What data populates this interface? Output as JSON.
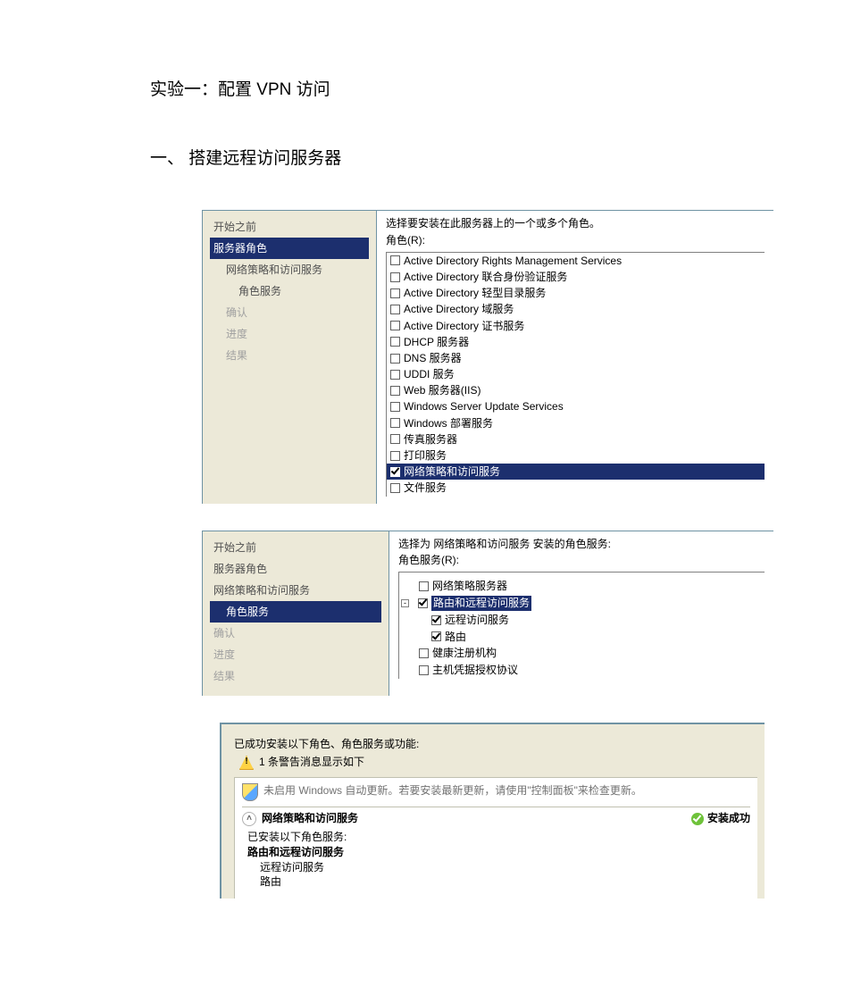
{
  "doc": {
    "title": "实验一：配置 VPN 访问",
    "subtitle": "一、  搭建远程访问服务器"
  },
  "dlg1": {
    "sidebar": {
      "s0": "开始之前",
      "s1": "服务器角色",
      "s2": "网络策略和访问服务",
      "s3": "角色服务",
      "s4": "确认",
      "s5": "进度",
      "s6": "结果"
    },
    "prompt": "选择要安装在此服务器上的一个或多个角色。",
    "legend": "角色(R):",
    "roles": {
      "r0": "Active Directory Rights Management Services",
      "r1": "Active Directory 联合身份验证服务",
      "r2": "Active Directory 轻型目录服务",
      "r3": "Active Directory 域服务",
      "r4": "Active Directory 证书服务",
      "r5": "DHCP 服务器",
      "r6": "DNS 服务器",
      "r7": "UDDI 服务",
      "r8": "Web 服务器(IIS)",
      "r9": "Windows Server Update Services",
      "r10": "Windows 部署服务",
      "r11": "传真服务器",
      "r12": "打印服务",
      "r13": "网络策略和访问服务",
      "r14": "文件服务"
    }
  },
  "dlg2": {
    "sidebar": {
      "s0": "开始之前",
      "s1": "服务器角色",
      "s2": "网络策略和访问服务",
      "s3": "角色服务",
      "s4": "确认",
      "s5": "进度",
      "s6": "结果"
    },
    "prompt": "选择为 网络策略和访问服务 安装的角色服务:",
    "legend": "角色服务(R):",
    "tree": {
      "t0": "网络策略服务器",
      "t1": "路由和远程访问服务",
      "t2": "远程访问服务",
      "t3": "路由",
      "t4": "健康注册机构",
      "t5": "主机凭据授权协议"
    }
  },
  "dlg3": {
    "header": "已成功安装以下角色、角色服务或功能:",
    "warn": "1 条警告消息显示如下",
    "autoupd": "未启用 Windows 自动更新。若要安装最新更新，请使用\"控制面板\"来检查更新。",
    "roleName": "网络策略和访问服务",
    "status": "安装成功",
    "installedHdr": "已安装以下角色服务:",
    "svc0": "路由和远程访问服务",
    "svc1": "远程访问服务",
    "svc2": "路由"
  }
}
